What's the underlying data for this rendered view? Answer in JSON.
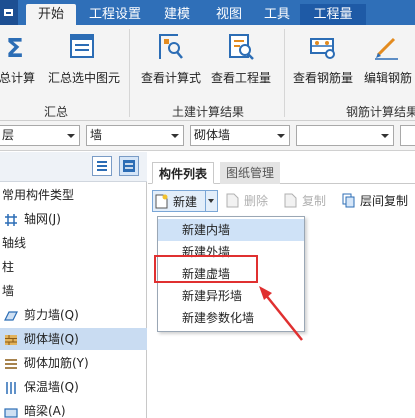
{
  "menubar": {
    "tabs": [
      {
        "label": "开始"
      },
      {
        "label": "工程设置"
      },
      {
        "label": "建模"
      },
      {
        "label": "视图"
      },
      {
        "label": "工具"
      },
      {
        "label": "工程量"
      }
    ],
    "active_tab": "工程量"
  },
  "ribbon": {
    "groups": [
      {
        "label": "汇总",
        "buttons": [
          {
            "label": "总计算",
            "icon": "sigma-icon"
          },
          {
            "label": "汇总选中图元",
            "icon": "summary-selected-icon"
          }
        ]
      },
      {
        "label": "土建计算结果",
        "buttons": [
          {
            "label": "查看计算式",
            "icon": "view-formula-icon"
          },
          {
            "label": "查看工程量",
            "icon": "view-quantity-icon"
          }
        ]
      },
      {
        "label": "钢筋计算结果",
        "buttons": [
          {
            "label": "查看钢筋量",
            "icon": "view-rebar-icon"
          },
          {
            "label": "编辑钢筋",
            "icon": "edit-rebar-icon"
          }
        ]
      }
    ]
  },
  "filters": {
    "floor": "层",
    "type": "墙",
    "subtype": "砌体墙",
    "component": ""
  },
  "tree": {
    "root": "常用构件类型",
    "items": [
      {
        "label": "轴网(J)",
        "icon": "axis-grid-icon"
      },
      {
        "label": "轴线"
      },
      {
        "label": "柱"
      },
      {
        "label": "墙"
      },
      {
        "label": "剪力墙(Q)",
        "icon": "shear-wall-icon"
      },
      {
        "label": "砌体墙(Q)",
        "icon": "masonry-wall-icon",
        "selected": true
      },
      {
        "label": "砌体加筋(Y)",
        "icon": "masonry-rebar-icon"
      },
      {
        "label": "保温墙(Q)",
        "icon": "insulation-wall-icon"
      },
      {
        "label": "暗梁(A)",
        "icon": "hidden-beam-icon"
      }
    ]
  },
  "panel": {
    "tabs": [
      "构件列表",
      "图纸管理"
    ],
    "toolbar": {
      "new": "新建",
      "delete": "删除",
      "copy": "复制",
      "copy_floor": "层间复制"
    }
  },
  "dropdown": {
    "items": [
      "新建内墙",
      "新建外墙",
      "新建虚墙",
      "新建异形墙",
      "新建参数化墙"
    ],
    "highlighted_index": 0,
    "annotated_index": 2
  },
  "colors": {
    "menubar": "#2f6fb8",
    "annotation": "#e03030",
    "selection": "#c9dcf2"
  }
}
